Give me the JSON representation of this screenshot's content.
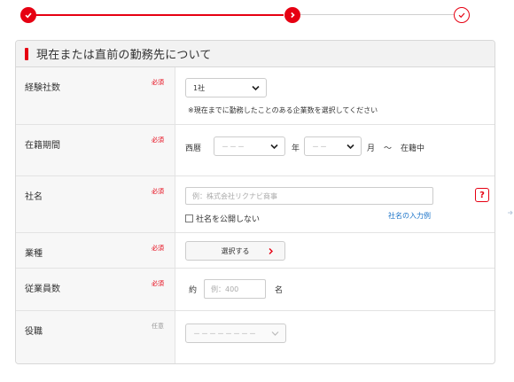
{
  "colors": {
    "accent": "#e60012",
    "link": "#1a73c8",
    "label_bg": "#f7f7f7"
  },
  "progress": {
    "steps": [
      {
        "state": "done",
        "icon": "check-icon"
      },
      {
        "state": "current",
        "icon": "chevron-right-icon"
      },
      {
        "state": "upcoming",
        "icon": "check-circle-icon"
      }
    ]
  },
  "section": {
    "title": "現在または直前の勤務先について",
    "required_tag": "必須",
    "optional_tag": "任意"
  },
  "fields": {
    "companies_count": {
      "label": "経験社数",
      "value": "1社",
      "note": "※現在までに勤務したことのある企業数を選択してください"
    },
    "tenure": {
      "label": "在籍期間",
      "era": "西暦",
      "year_placeholder": "－－－",
      "year_unit": "年",
      "month_placeholder": "－－",
      "month_unit": "月",
      "tilde": "～",
      "current": "在籍中"
    },
    "company_name": {
      "label": "社名",
      "placeholder": "例：株式会社リクナビ商事",
      "help": "?",
      "hide_checkbox_label": "社名を公開しない",
      "example_link": "社名の入力例"
    },
    "industry": {
      "label": "業種",
      "button_label": "選択する"
    },
    "employees": {
      "label": "従業員数",
      "prefix": "約",
      "placeholder": "例：400",
      "suffix": "名"
    },
    "position": {
      "label": "役職",
      "placeholder": "－－－－－－－－"
    }
  }
}
